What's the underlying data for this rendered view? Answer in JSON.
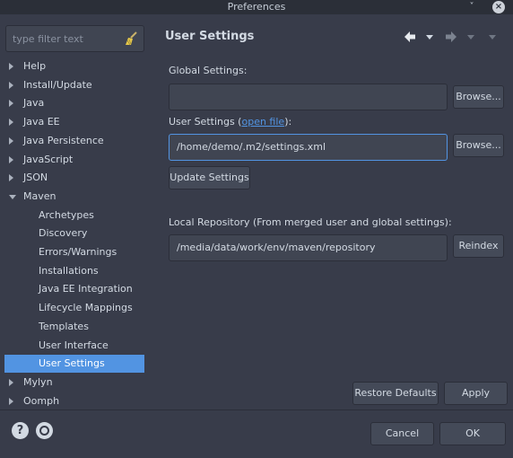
{
  "window": {
    "title": "Preferences",
    "minimize_glyph": "˅",
    "close_glyph": "×"
  },
  "filter": {
    "placeholder": "type filter text",
    "value": ""
  },
  "tree": [
    {
      "label": "Help",
      "expanded": false,
      "child": false
    },
    {
      "label": "Install/Update",
      "expanded": false,
      "child": false
    },
    {
      "label": "Java",
      "expanded": false,
      "child": false
    },
    {
      "label": "Java EE",
      "expanded": false,
      "child": false
    },
    {
      "label": "Java Persistence",
      "expanded": false,
      "child": false
    },
    {
      "label": "JavaScript",
      "expanded": false,
      "child": false
    },
    {
      "label": "JSON",
      "expanded": false,
      "child": false
    },
    {
      "label": "Maven",
      "expanded": true,
      "child": false
    },
    {
      "label": "Archetypes",
      "child": true
    },
    {
      "label": "Discovery",
      "child": true
    },
    {
      "label": "Errors/Warnings",
      "child": true
    },
    {
      "label": "Installations",
      "child": true
    },
    {
      "label": "Java EE Integration",
      "child": true
    },
    {
      "label": "Lifecycle Mappings",
      "child": true
    },
    {
      "label": "Templates",
      "child": true
    },
    {
      "label": "User Interface",
      "child": true
    },
    {
      "label": "User Settings",
      "child": true,
      "selected": true
    },
    {
      "label": "Mylyn",
      "expanded": false,
      "child": false
    },
    {
      "label": "Oomph",
      "expanded": false,
      "child": false
    }
  ],
  "page": {
    "title": "User Settings",
    "global_settings_label": "Global Settings:",
    "global_settings_value": "",
    "user_settings_label_prefix": "User Settings (",
    "user_settings_link": "open file",
    "user_settings_label_suffix": "):",
    "user_settings_value": "/home/demo/.m2/settings.xml",
    "browse_label": "Browse...",
    "update_settings_label": "Update Settings",
    "local_repo_label": "Local Repository (From merged user and global settings):",
    "local_repo_value": "/media/data/work/env/maven/repository",
    "reindex_label": "Reindex",
    "restore_defaults_label": "Restore Defaults",
    "apply_label": "Apply"
  },
  "footer": {
    "help_glyph": "?",
    "cancel_label": "Cancel",
    "ok_label": "OK"
  },
  "colors": {
    "accent": "#5294e2",
    "background": "#383c4a",
    "field": "#404552",
    "button": "#444a58",
    "text": "#d3dae3"
  }
}
